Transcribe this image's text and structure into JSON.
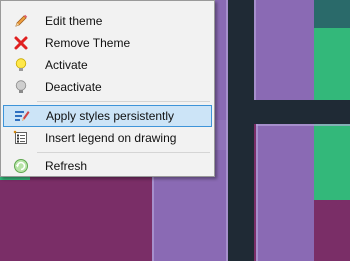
{
  "context_menu": {
    "items": [
      {
        "label": "Edit theme",
        "icon": "pencil-icon"
      },
      {
        "label": "Remove Theme",
        "icon": "red-x-icon"
      },
      {
        "label": "Activate",
        "icon": "lightbulb-on-icon"
      },
      {
        "label": "Deactivate",
        "icon": "lightbulb-off-icon"
      },
      {
        "label": "Apply styles persistently",
        "icon": "paint-brush-icon",
        "highlighted": true
      },
      {
        "label": "Insert legend on drawing",
        "icon": "legend-icon"
      },
      {
        "label": "Refresh",
        "icon": "refresh-icon"
      }
    ]
  },
  "colors": {
    "menu_bg": "#f2f2f2",
    "highlight_bg": "#cce4f7",
    "highlight_border": "#3e94d9",
    "map_purple": "#7a2e67",
    "map_violet": "#8a6ab4",
    "map_green": "#33b87a",
    "map_road": "#1f2a35"
  }
}
